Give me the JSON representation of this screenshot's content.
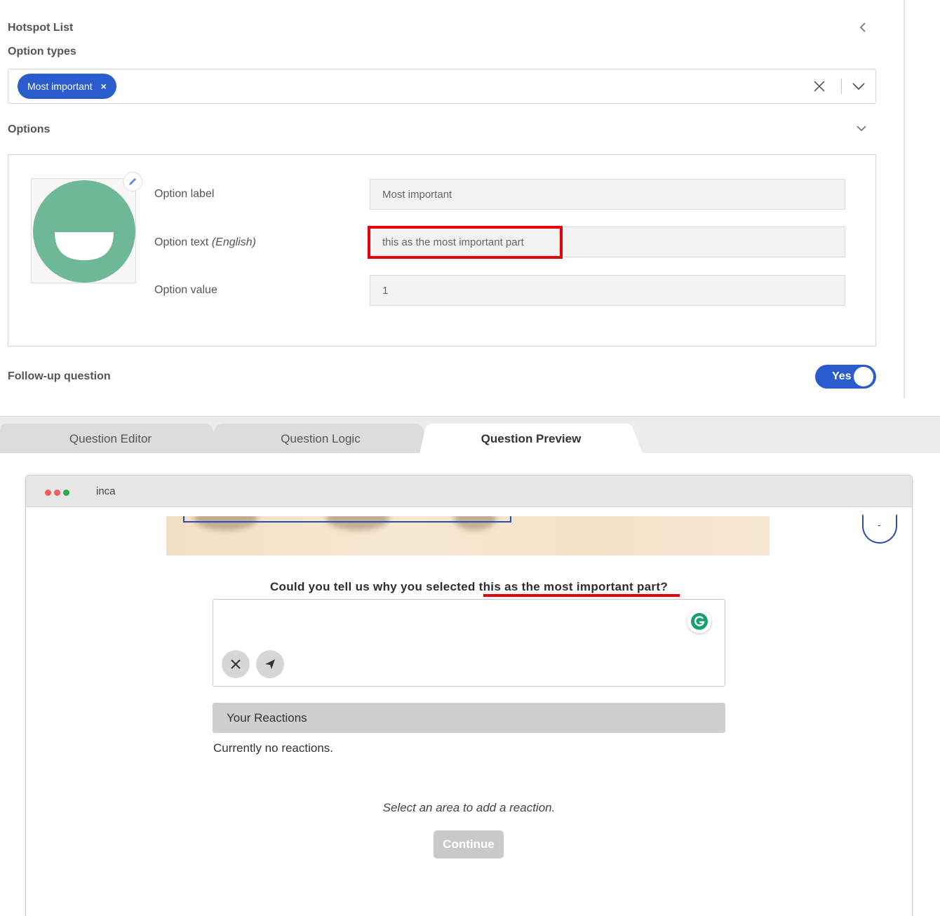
{
  "editor": {
    "section_title": "Hotspot List",
    "option_types_label": "Option types",
    "selected_chip": "Most important",
    "chip_remove_glyph": "×",
    "options_label": "Options",
    "option_label_caption": "Option label",
    "option_label_value": "Most important",
    "option_text_caption": "Option text",
    "option_text_language": "(English)",
    "option_text_value": "this as the most important part",
    "option_value_caption": "Option value",
    "option_value_value": "1",
    "followup_label": "Follow-up question",
    "followup_toggle": "Yes",
    "image_icon": "smiley-face-icon",
    "accent_color": "#2a5ccd",
    "highlight_color": "#e8000b"
  },
  "tabs": [
    {
      "label": "Question Editor",
      "active": false
    },
    {
      "label": "Question Logic",
      "active": false
    },
    {
      "label": "Question Preview",
      "active": true
    }
  ],
  "preview": {
    "window_title": "inca",
    "question": "Could you tell us why you selected this as the most important part?",
    "reactions_header": "Your Reactions",
    "no_reactions": "Currently no reactions.",
    "select_hint": "Select an area to add a reaction.",
    "continue_label": "Continue",
    "timer_text": "-"
  }
}
